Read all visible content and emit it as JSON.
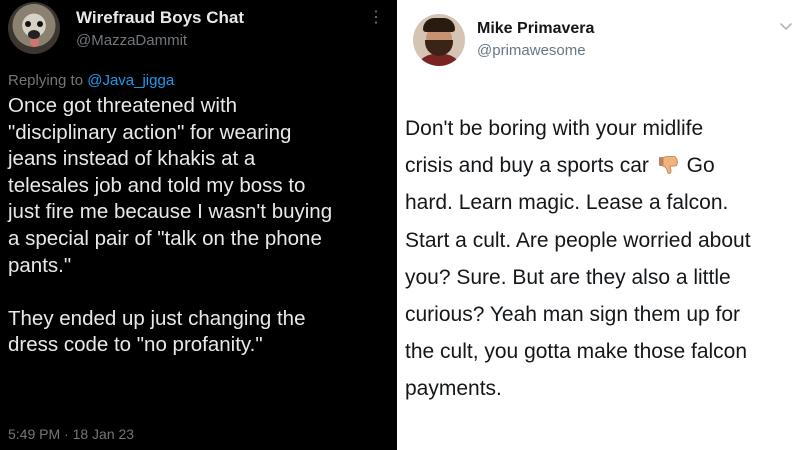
{
  "left_tweet": {
    "display_name": "Wirefraud Boys Chat",
    "handle": "@MazzaDammit",
    "replying_prefix": "Replying to ",
    "replying_to": "@Java_jigga",
    "body_lines": [
      "Once got threatened with",
      "\"disciplinary action\" for wearing",
      "jeans instead of khakis at a",
      "telesales job and told my boss to",
      "just fire me because I wasn't buying",
      "a special pair of \"talk on the phone",
      "pants.\"",
      "",
      "They ended up just changing the",
      "dress code to \"no profanity.\""
    ],
    "timestamp": "5:49 PM · 18 Jan 23",
    "more_icon": "more-vertical-icon"
  },
  "right_tweet": {
    "display_name": "Mike Primavera",
    "handle": "@primawesome",
    "body_lines": [
      "Don't be boring with your midlife",
      "crisis and buy a sports car",
      "hard. Learn magic. Lease a falcon.",
      "Start a cult. Are people worried about",
      "you? Sure. But are they also a little",
      "curious? Yeah man sign them up for",
      "the cult, you gotta make those falcon",
      "payments."
    ],
    "line2_after_emoji": "Go",
    "emoji": "thumbs-down-emoji",
    "menu_icon": "chevron-down-icon"
  },
  "colors": {
    "left_bg": "#000000",
    "left_text": "#e7e9ea",
    "left_muted": "#71767b",
    "link": "#1d9bf0",
    "right_bg": "#ffffff",
    "right_text": "#14171a",
    "right_muted": "#657786"
  }
}
